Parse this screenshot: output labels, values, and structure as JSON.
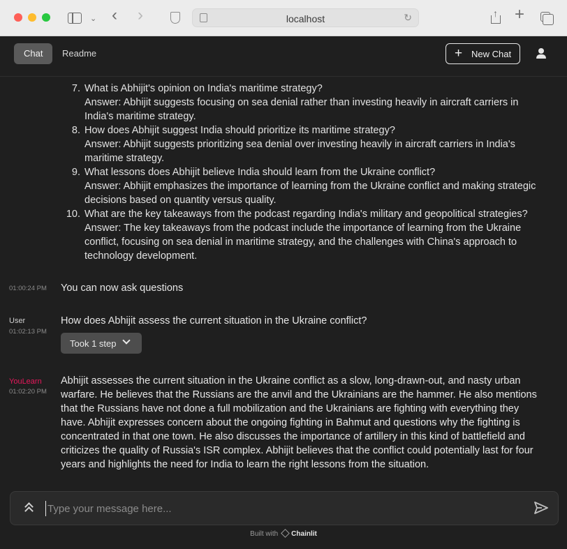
{
  "browser": {
    "url": "localhost"
  },
  "header": {
    "tabs": [
      {
        "label": "Chat"
      },
      {
        "label": "Readme"
      }
    ],
    "new_chat_label": "New Chat"
  },
  "qa_items": [
    {
      "num": "7.",
      "lines": [
        "What is Abhijit's opinion on India's maritime strategy?",
        "Answer: Abhijit suggests focusing on sea denial rather than investing heavily in aircraft carriers in",
        "India's maritime strategy."
      ]
    },
    {
      "num": "8.",
      "lines": [
        "How does Abhijit suggest India should prioritize its maritime strategy?",
        "Answer: Abhijit suggests prioritizing sea denial over investing heavily in aircraft carriers in India's",
        "maritime strategy."
      ]
    },
    {
      "num": "9.",
      "lines": [
        "What lessons does Abhijit believe India should learn from the Ukraine conflict?",
        "Answer: Abhijit emphasizes the importance of learning from the Ukraine conflict and making strategic",
        "decisions based on quantity versus quality."
      ]
    },
    {
      "num": "10.",
      "lines": [
        "What are the key takeaways from the podcast regarding India's military and geopolitical strategies?",
        "Answer: The key takeaways from the podcast include the importance of learning from the Ukraine",
        "conflict, focusing on sea denial in maritime strategy, and the challenges with China's approach to",
        "technology development."
      ]
    }
  ],
  "messages": [
    {
      "author": "",
      "time": "01:00:24 PM",
      "text": "You can now ask questions"
    },
    {
      "author": "User",
      "time": "01:02:13 PM",
      "text": "How does Abhijit assess the current situation in the Ukraine conflict?",
      "step_label": "Took 1 step"
    },
    {
      "author": "YouLearn",
      "time": "01:02:20 PM",
      "lines": [
        "Abhijit assesses the current situation in the Ukraine conflict as a slow, long-drawn-out, and nasty urban",
        "warfare. He believes that the Russians are the anvil and the Ukrainians are the hammer. He also mentions",
        "that the Russians have not done a full mobilization and the Ukrainians are fighting with everything they",
        "have. Abhijit expresses concern about the ongoing fighting in Bahmut and questions why the fighting is",
        "concentrated in that one town. He also discusses the importance of artillery in this kind of battlefield and",
        "criticizes the quality of Russia's ISR complex. Abhijit believes that the conflict could potentially last for four",
        "years and highlights the need for India to learn the right lessons from the situation."
      ]
    }
  ],
  "composer": {
    "placeholder": "Type your message here..."
  },
  "footer": {
    "built_with": "Built with",
    "brand": "Chainlit"
  },
  "colors": {
    "bot_author": "#e8185c",
    "background": "#1f1f1f"
  },
  "icons": [
    "sidebar-icon",
    "chevron-down-icon",
    "back-icon",
    "forward-icon",
    "shield-icon",
    "page-icon",
    "reload-icon",
    "share-icon",
    "plus-icon",
    "tabs-icon",
    "user-icon",
    "expand-icon",
    "send-icon",
    "chainlit-logo-icon"
  ]
}
